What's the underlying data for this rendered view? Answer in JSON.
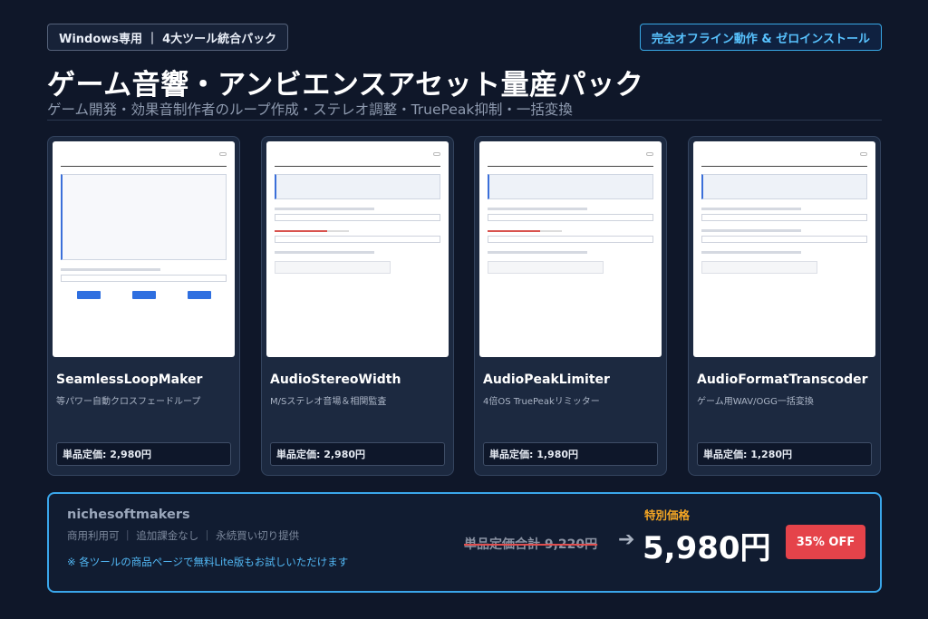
{
  "header": {
    "platform_badge": "Windows専用 ｜ 4大ツール統合パック",
    "offline_badge": "完全オフライン動作 & ゼロインストール",
    "title": "ゲーム音響・アンビエンスアセット量産パック",
    "subtitle": "ゲーム開発・効果音制作者のループ作成・ステレオ調整・TruePeak抑制・一括変換"
  },
  "products": [
    {
      "name": "SeamlessLoopMaker",
      "description": "等パワー自動クロスフェードループ",
      "price": "単品定価: 2,980円"
    },
    {
      "name": "AudioStereoWidth",
      "description": "M/Sステレオ音場＆相関監査",
      "price": "単品定価: 2,980円"
    },
    {
      "name": "AudioPeakLimiter",
      "description": "4倍OS TruePeakリミッター",
      "price": "単品定価: 1,980円"
    },
    {
      "name": "AudioFormatTranscoder",
      "description": "ゲーム用WAV/OGG一括変換",
      "price": "単品定価: 1,280円"
    }
  ],
  "bundle": {
    "brand": "nichesoftmakers",
    "terms": "商用利用可 ｜ 追加課金なし ｜ 永続買い切り提供",
    "note": "※ 各ツールの商品ページで無料Lite版もお試しいただけます",
    "special_label": "特別価格",
    "original_total": "単品定価合計 9,220円",
    "arrow": "➔",
    "price": "5,980円",
    "discount": "35% OFF"
  },
  "colors": {
    "background": "#0f1729",
    "card": "#1c2940",
    "accent_blue": "#3aa6ea",
    "accent_orange": "#f5a623",
    "discount_red": "#e5434a"
  }
}
